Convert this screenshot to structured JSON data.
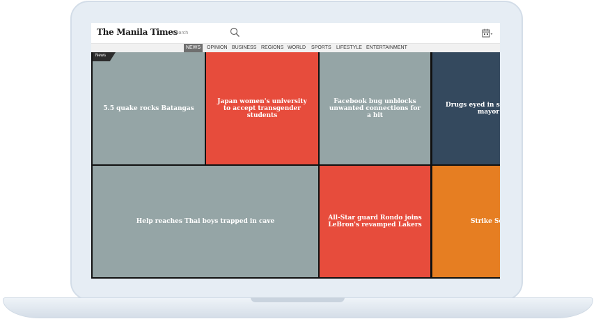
{
  "header": {
    "logo": "The Manila Times",
    "search_placeholder": "Search"
  },
  "nav": {
    "items": [
      "NEWS",
      "OPINION",
      "BUSINESS",
      "REGIONS",
      "WORLD",
      "SPORTS",
      "LIFESTYLE",
      "ENTERTAINMENT"
    ],
    "active": "NEWS"
  },
  "section_tag": "News",
  "tiles": [
    {
      "title": "5.5 quake rocks Batangas",
      "color": "#95a5a6"
    },
    {
      "title": "Japan women's university to accept transgender students",
      "color": "#e74c3c"
    },
    {
      "title": "Facebook bug unblocks unwanted connections for a bit",
      "color": "#95a5a6"
    },
    {
      "title": "Drugs eyed in slay of ex-mayor",
      "color": "#34495e"
    },
    {
      "title": "Help reaches Thai boys trapped in cave",
      "color": "#95a5a6"
    },
    {
      "title": "All-Star guard Rondo joins LeBron's revamped Lakers",
      "color": "#e74c3c"
    },
    {
      "title": "Strike Ser",
      "color": "#e67e22"
    }
  ],
  "icons": {
    "search": "search-icon",
    "calendar": "calendar-icon"
  }
}
